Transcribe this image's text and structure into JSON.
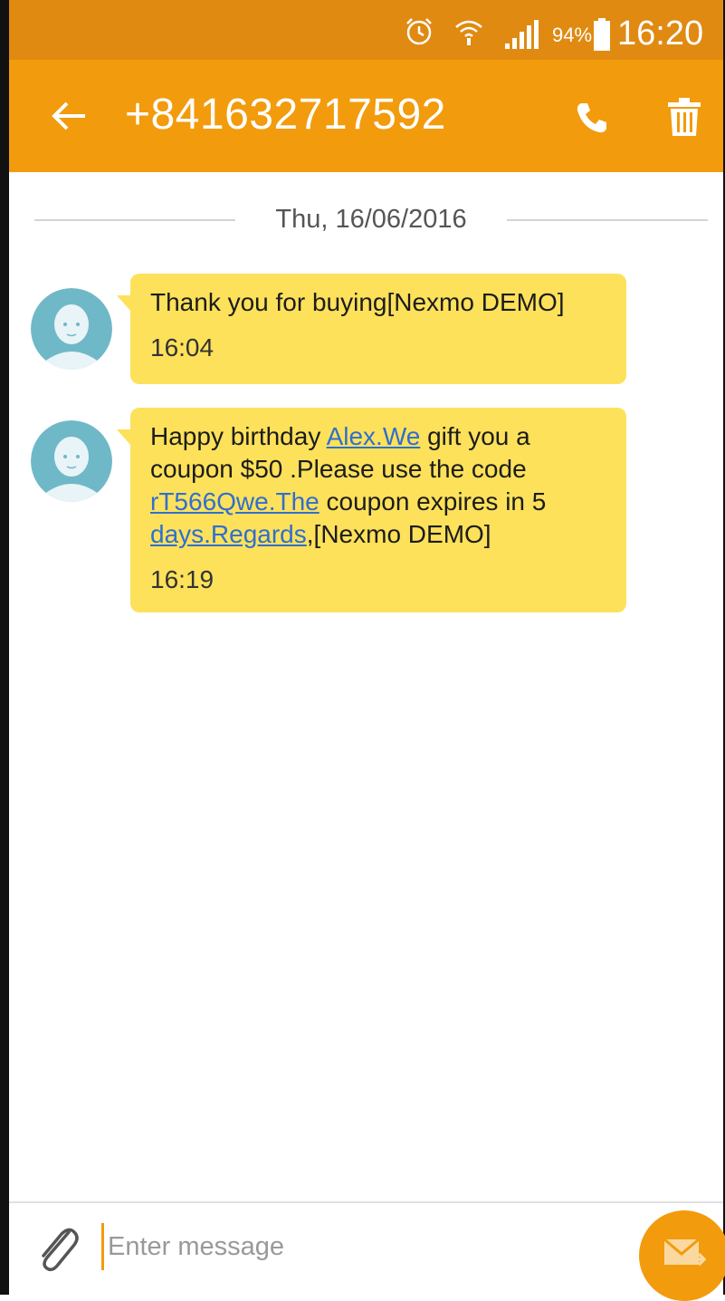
{
  "status_bar": {
    "battery_pct": "94%",
    "time": "16:20",
    "icons": [
      "alarm-icon",
      "wifi-icon",
      "signal-icon",
      "battery-icon"
    ]
  },
  "header": {
    "title": "+841632717592",
    "icons": [
      "back-arrow-icon",
      "phone-icon",
      "trash-icon"
    ]
  },
  "thread": {
    "date": "Thu, 16/06/2016",
    "messages": [
      {
        "text": "Thank you for buying[Nexmo DEMO]",
        "time": "16:04"
      },
      {
        "parts": [
          "Happy birthday ",
          "Alex.We",
          " gift you a coupon $50 .Please use the code ",
          "rT566Qwe.The",
          " coupon expires in 5 ",
          "days.Regards",
          ",[Nexmo DEMO]"
        ],
        "time": "16:19"
      }
    ]
  },
  "composer": {
    "placeholder": "Enter message",
    "icons": [
      "paperclip-icon",
      "send-mail-icon"
    ]
  },
  "colors": {
    "status_bar": "#e08a12",
    "app_bar": "#f29b0c",
    "bubble": "#fde15a",
    "link": "#2f6fd0",
    "avatar": "#6fb8c8"
  }
}
